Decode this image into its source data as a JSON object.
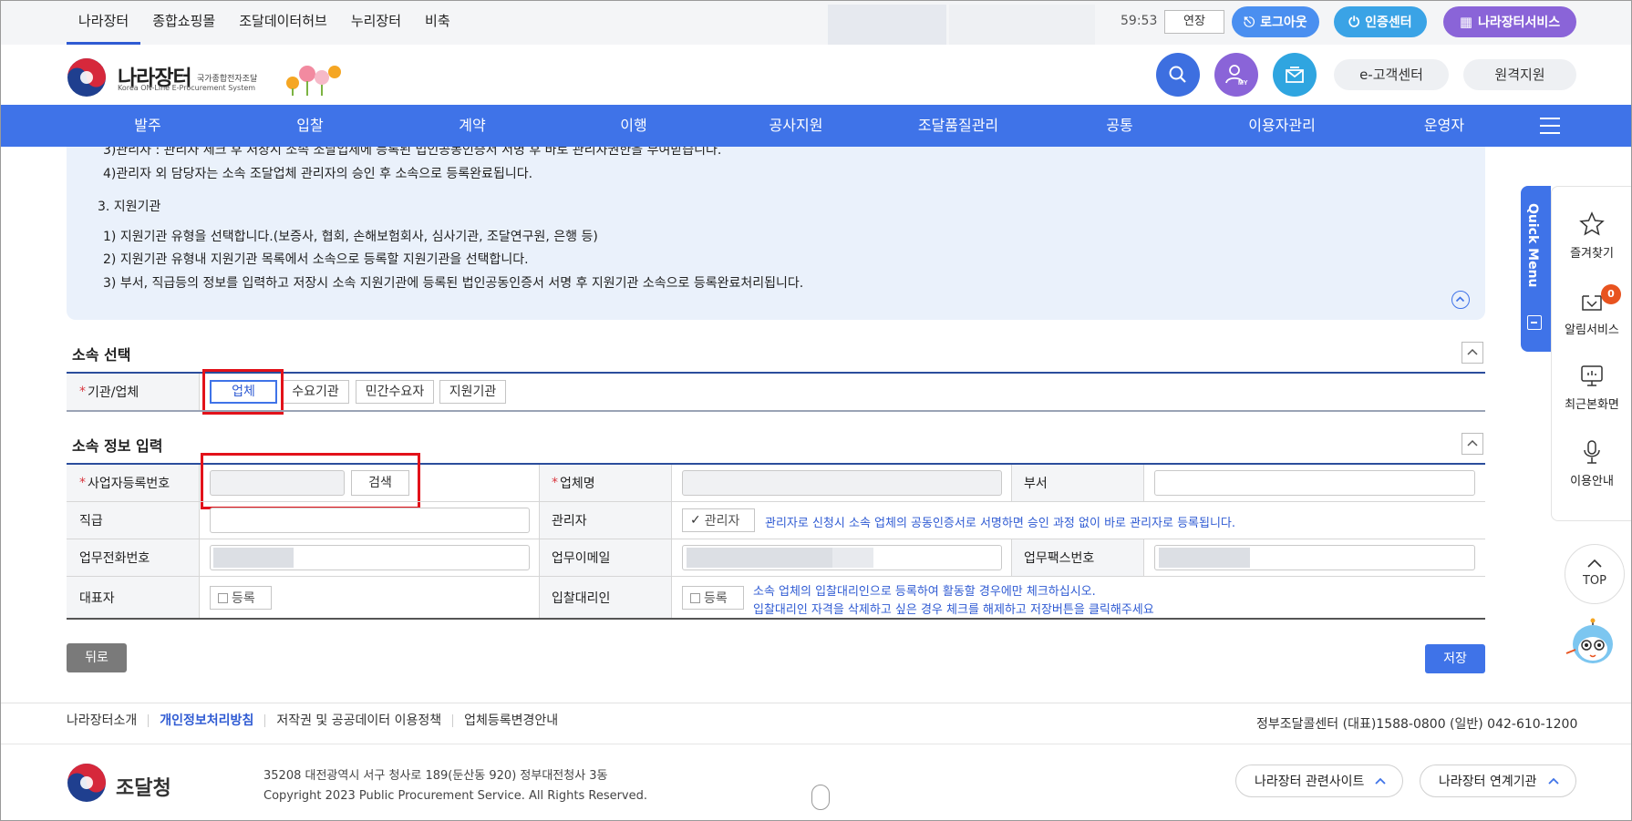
{
  "topbar": {
    "nav": [
      "나라장터",
      "종합쇼핑몰",
      "조달데이터허브",
      "누리장터",
      "비축"
    ],
    "timer": "59:53",
    "extend_label": "연장",
    "logout_label": "로그아웃",
    "cert_label": "인증센터",
    "service_label": "나라장터서비스"
  },
  "header": {
    "logo_title": "나라장터",
    "logo_sub": "국가종합전자조달",
    "logo_eng": "Korea ON-Line E-Procurement System",
    "my_label": "MY",
    "customer_center": "e-고객센터",
    "remote_support": "원격지원"
  },
  "mainnav": [
    "발주",
    "입찰",
    "계약",
    "이행",
    "공사지원",
    "조달품질관리",
    "공통",
    "이용자관리",
    "운영자"
  ],
  "info": {
    "lines": [
      "3)관리자 : 관리자 체크 후 저장시 소속 조달업체에 등록된 법인공동인증서 서명 후 바로 관리자권한을 부여받습니다.",
      "4)관리자 외 담당자는 소속 조달업체 관리자의 승인 후 소속으로 등록완료됩니다.",
      "3. 지원기관",
      "1) 지원기관 유형을 선택합니다.(보증사, 협회, 손해보험회사, 심사기관, 조달연구원, 은행 등)",
      "2) 지원기관 유형내 지원기관 목록에서 소속으로 등록할 지원기관을 선택합니다.",
      "3) 부서, 직급등의 정보를 입력하고 저장시 소속 지원기관에 등록된 법인공동인증서 서명 후 지원기관 소속으로 등록완료처리됩니다."
    ]
  },
  "affiliation": {
    "title": "소속 선택",
    "org_label": "기관/업체",
    "options": [
      "업체",
      "수요기관",
      "민간수요자",
      "지원기관"
    ],
    "selected": "업체"
  },
  "form": {
    "title": "소속 정보 입력",
    "biz_no_label": "사업자등록번호",
    "search_label": "검색",
    "company_label": "업체명",
    "dept_label": "부서",
    "rank_label": "직급",
    "admin_label": "관리자",
    "admin_check": "관리자",
    "admin_note": "관리자로 신청시 소속 업체의 공동인증서로 서명하면 승인 과정 없이 바로 관리자로 등록됩니다.",
    "phone_label": "업무전화번호",
    "email_label": "업무이메일",
    "fax_label": "업무팩스번호",
    "ceo_label": "대표자",
    "register_label": "등록",
    "agent_label": "입찰대리인",
    "agent_note1": "소속 업체의 입찰대리인으로 등록하여 활동할 경우에만 체크하십시오.",
    "agent_note2": "입찰대리인 자격을 삭제하고 싶은 경우 체크를 해제하고 저장버튼을 클릭해주세요"
  },
  "actions": {
    "back": "뒤로",
    "save": "저장"
  },
  "footer": {
    "links": [
      "나라장터소개",
      "개인정보처리방침",
      "저작권 및 공공데이터 이용정책",
      "업체등록변경안내"
    ],
    "callcenter": "정부조달콜센터  (대표)1588-0800  (일반) 042-610-1200",
    "org_name": "조달청",
    "address": "35208 대전광역시 서구 청사로 189(둔산동 920) 정부대전청사 3동",
    "copyright": "Copyright 2023 Public Procurement Service. All Rights Reserved.",
    "related_sites": "나라장터 관련사이트",
    "linked_orgs": "나라장터 연계기관"
  },
  "quickmenu": {
    "title": "Quick Menu",
    "items": [
      "즐겨찾기",
      "알림서비스",
      "최근본화면",
      "이용안내"
    ],
    "alert_count": "0",
    "top_label": "TOP"
  },
  "colors": {
    "primary": "#3f73e8",
    "highlight": "#e2121a",
    "info_bg": "#eaf1fb"
  }
}
